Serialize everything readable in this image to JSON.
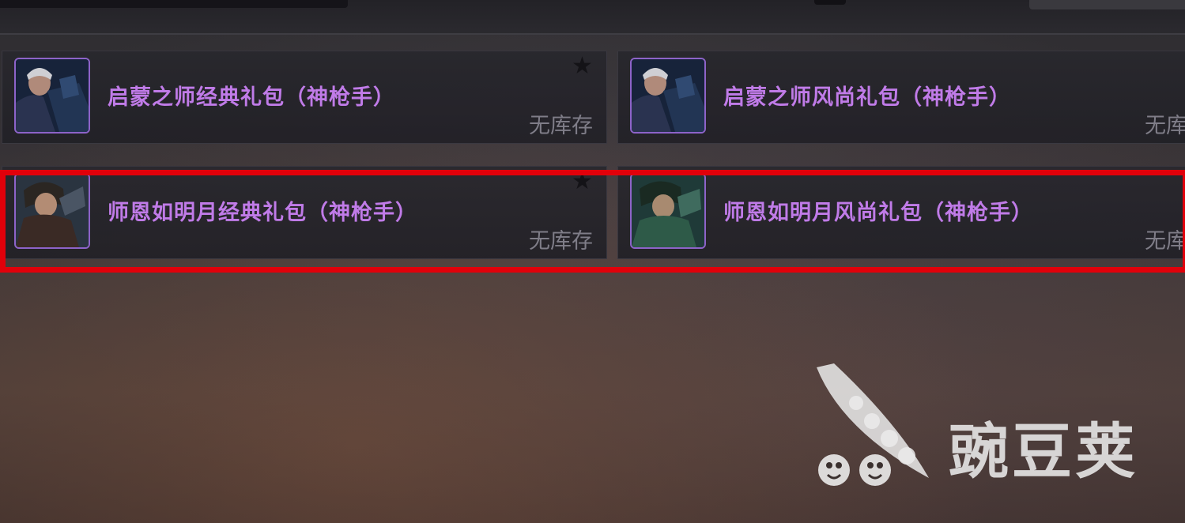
{
  "items": [
    {
      "title": "启蒙之师经典礼包（神枪手）",
      "stock": "无库存",
      "favorite_icon": "star-icon",
      "portrait_icon": "character-portrait-icon"
    },
    {
      "title": "启蒙之师风尚礼包（神枪手）",
      "stock": "无库存",
      "favorite_icon": "star-icon",
      "portrait_icon": "character-portrait-icon"
    },
    {
      "title": "师恩如明月经典礼包（神枪手）",
      "stock": "无库存",
      "favorite_icon": "star-icon",
      "portrait_icon": "character-portrait-icon"
    },
    {
      "title": "师恩如明月风尚礼包（神枪手）",
      "stock": "无库存",
      "favorite_icon": "star-icon",
      "portrait_icon": "character-portrait-icon"
    }
  ],
  "highlight_color": "#e1000a",
  "title_color": "#c07be8",
  "watermark": {
    "text": "豌豆荚",
    "icon": "pea-pod-logo-icon"
  }
}
